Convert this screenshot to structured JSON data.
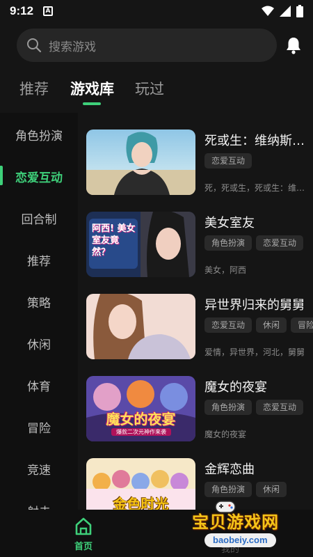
{
  "status_bar": {
    "time": "9:12",
    "notification_badge": "A"
  },
  "search": {
    "placeholder": "搜索游戏"
  },
  "tabs": [
    {
      "label": "推荐",
      "active": false
    },
    {
      "label": "游戏库",
      "active": true
    },
    {
      "label": "玩过",
      "active": false
    }
  ],
  "sidebar": {
    "items": [
      {
        "label": "角色扮演",
        "active": false
      },
      {
        "label": "恋爱互动",
        "active": true
      },
      {
        "label": "回合制",
        "active": false
      },
      {
        "label": "推荐",
        "active": false
      },
      {
        "label": "策略",
        "active": false
      },
      {
        "label": "休闲",
        "active": false
      },
      {
        "label": "体育",
        "active": false
      },
      {
        "label": "冒险",
        "active": false
      },
      {
        "label": "竞速",
        "active": false
      },
      {
        "label": "射击",
        "active": false
      }
    ]
  },
  "games": [
    {
      "title": "死或生：维纳斯假期",
      "tags": [
        "恋爱互动"
      ],
      "keywords": "死，死或生，死或生：维纳斯假期"
    },
    {
      "title": "美女室友",
      "tags": [
        "角色扮演",
        "恋爱互动"
      ],
      "keywords": "美女，阿西",
      "thumb_caption": "阿西! 美女室友竟然？"
    },
    {
      "title": "异世界归来的舅舅",
      "tags": [
        "恋爱互动",
        "休闲",
        "冒险"
      ],
      "keywords": "爱情，异世界，河北，舅舅"
    },
    {
      "title": "魔女的夜宴",
      "tags": [
        "角色扮演",
        "恋爱互动"
      ],
      "keywords": "魔女的夜宴",
      "thumb_caption": "魔女的夜宴",
      "thumb_subcaption": "爆款二次元神作来袭"
    },
    {
      "title": "金辉恋曲",
      "tags": [
        "角色扮演",
        "休闲"
      ],
      "keywords": "",
      "thumb_caption": "金色时光"
    }
  ],
  "bottom_nav": {
    "home_label": "首页",
    "mine_label": "我的"
  },
  "watermark": {
    "text": "宝贝游戏网",
    "url": "baobeiy.com"
  },
  "colors": {
    "accent": "#3ed07a",
    "background": "#151515",
    "sidebar_bg": "#101010",
    "search_bg": "#262626"
  }
}
